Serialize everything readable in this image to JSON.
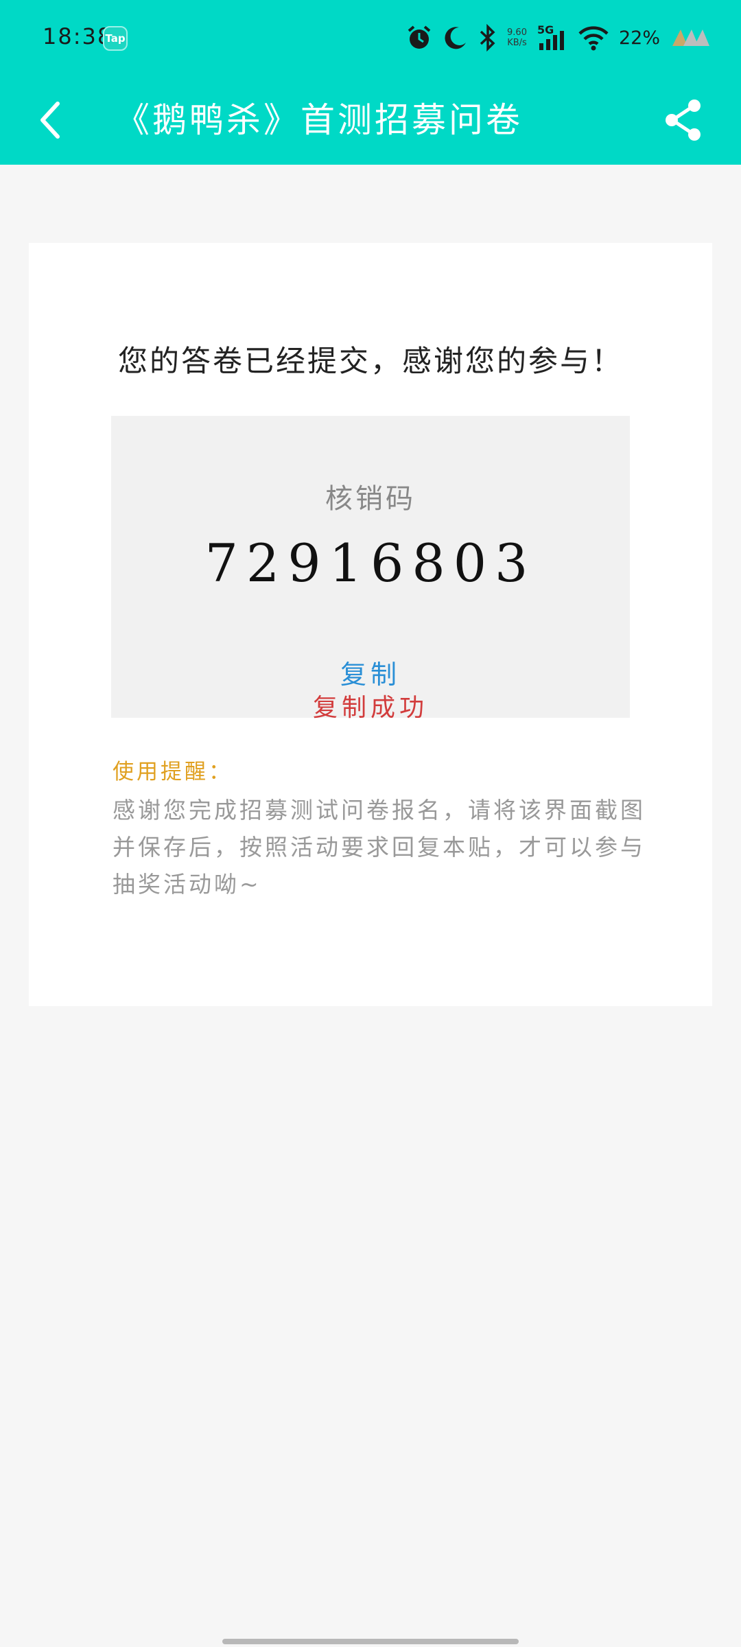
{
  "status_bar": {
    "time": "18:38",
    "tap_badge": "Tap",
    "net_speed_value": "9.60",
    "net_speed_unit": "KB/s",
    "signal_label": "5G",
    "battery": "22%"
  },
  "nav": {
    "title": "《鹅鸭杀》首测招募问卷"
  },
  "card": {
    "submitted_message": "您的答卷已经提交，感谢您的参与！",
    "code_label": "核销码",
    "code_value": "72916803",
    "copy_label": "复制",
    "copy_success": "复制成功",
    "tip_title": "使用提醒：",
    "tip_body": "感谢您完成招募测试问卷报名，请将该界面截图并保存后，按照活动要求回复本贴，才可以参与抽奖活动呦~"
  },
  "colors": {
    "header": "#00d9c6",
    "copy": "#2a8fd6",
    "success": "#d23c3c",
    "tip_title": "#e0a020"
  }
}
